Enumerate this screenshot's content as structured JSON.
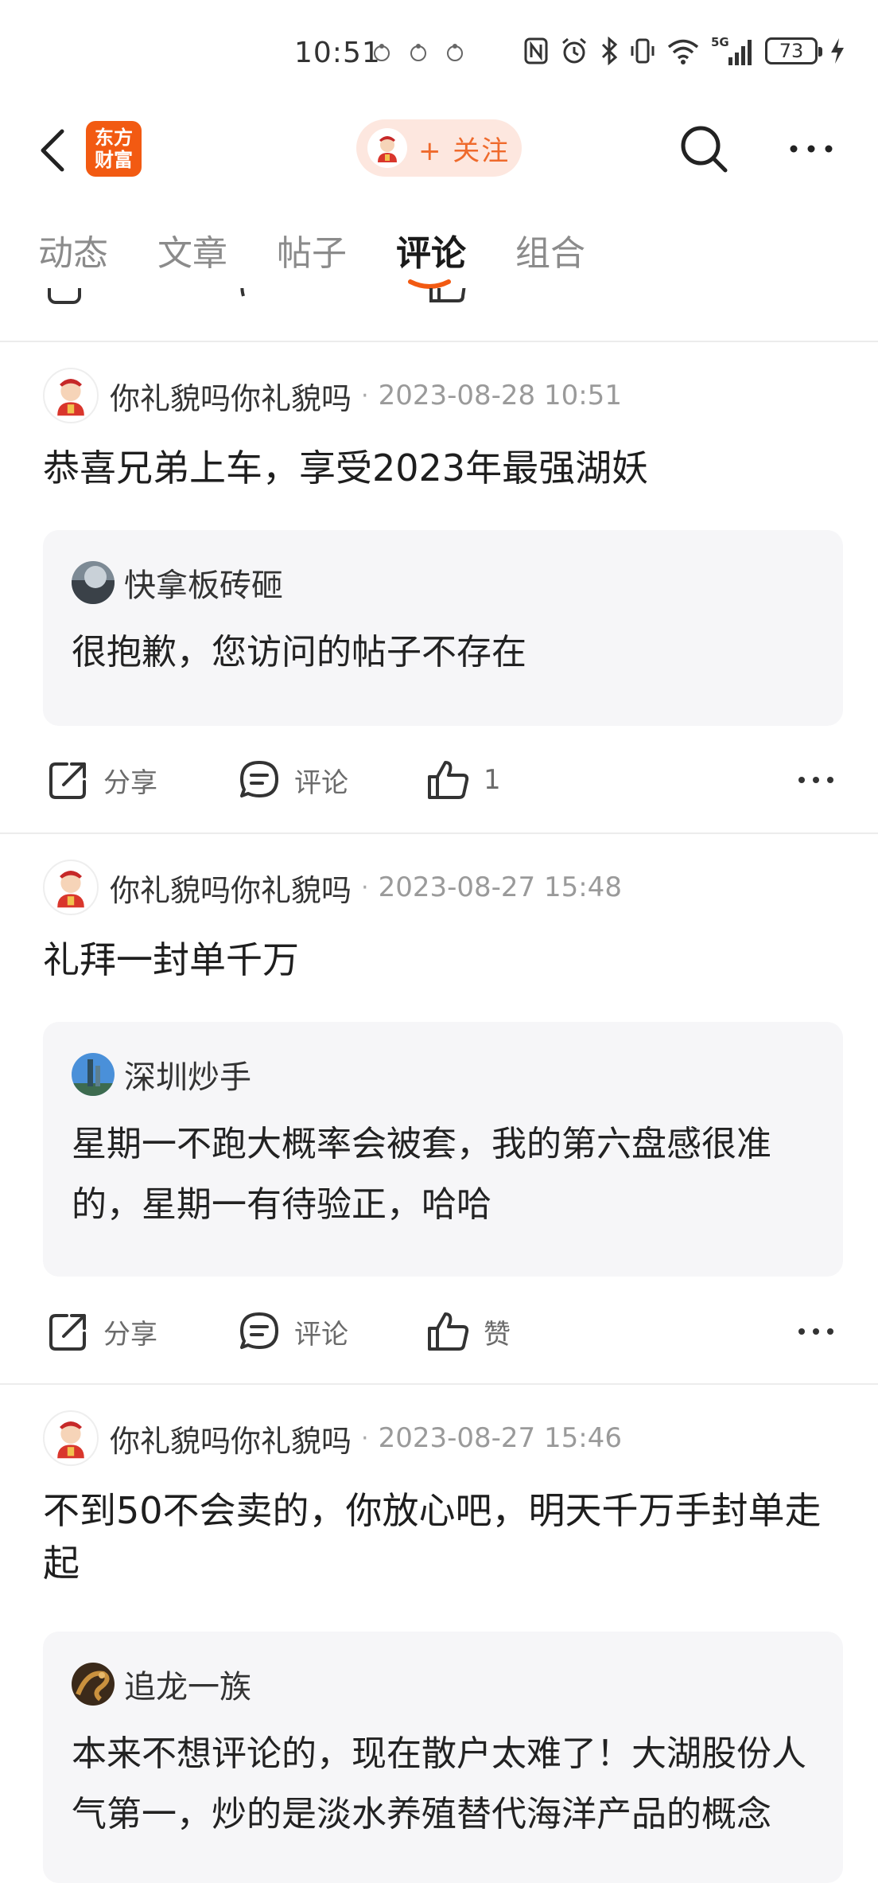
{
  "status_bar": {
    "time": "10:51",
    "battery": "73",
    "network": "5G"
  },
  "header": {
    "logo_text_line1": "东方",
    "logo_text_line2": "财富",
    "follow_label": "+ 关注",
    "icons": [
      "back-arrow-icon",
      "avatar-icon",
      "search-icon",
      "more-icon"
    ]
  },
  "tabs": [
    {
      "label": "动态",
      "active": false
    },
    {
      "label": "文章",
      "active": false
    },
    {
      "label": "帖子",
      "active": false
    },
    {
      "label": "评论",
      "active": true
    },
    {
      "label": "组合",
      "active": false
    }
  ],
  "colors": {
    "brand": "#f25a12",
    "follow_bg": "#fde7df",
    "follow_text": "#ef6a2c",
    "quote_bg": "#f6f6f8"
  },
  "posts": [
    {
      "author": "你礼貌吗你礼貌吗",
      "time": "2023-08-28 10:51",
      "text": "恭喜兄弟上车，享受2023年最强湖妖",
      "quote": {
        "author": "快拿板砖砸",
        "text": "很抱歉，您访问的帖子不存在"
      },
      "share_label": "分享",
      "comment_label": "评论",
      "like_label": "1"
    },
    {
      "author": "你礼貌吗你礼貌吗",
      "time": "2023-08-27 15:48",
      "text": "礼拜一封单千万",
      "quote": {
        "author": "深圳炒手",
        "text": "星期一不跑大概率会被套，我的第六盘感很准的，星期一有待验正，哈哈"
      },
      "share_label": "分享",
      "comment_label": "评论",
      "like_label": "赞"
    },
    {
      "author": "你礼貌吗你礼貌吗",
      "time": "2023-08-27 15:46",
      "text": "不到50不会卖的，你放心吧，明天千万手封单走起",
      "quote": {
        "author": "追龙一族",
        "text": "本来不想评论的，现在散户太难了！大湖股份人气第一，炒的是淡水养殖替代海洋产品的概念"
      }
    }
  ]
}
